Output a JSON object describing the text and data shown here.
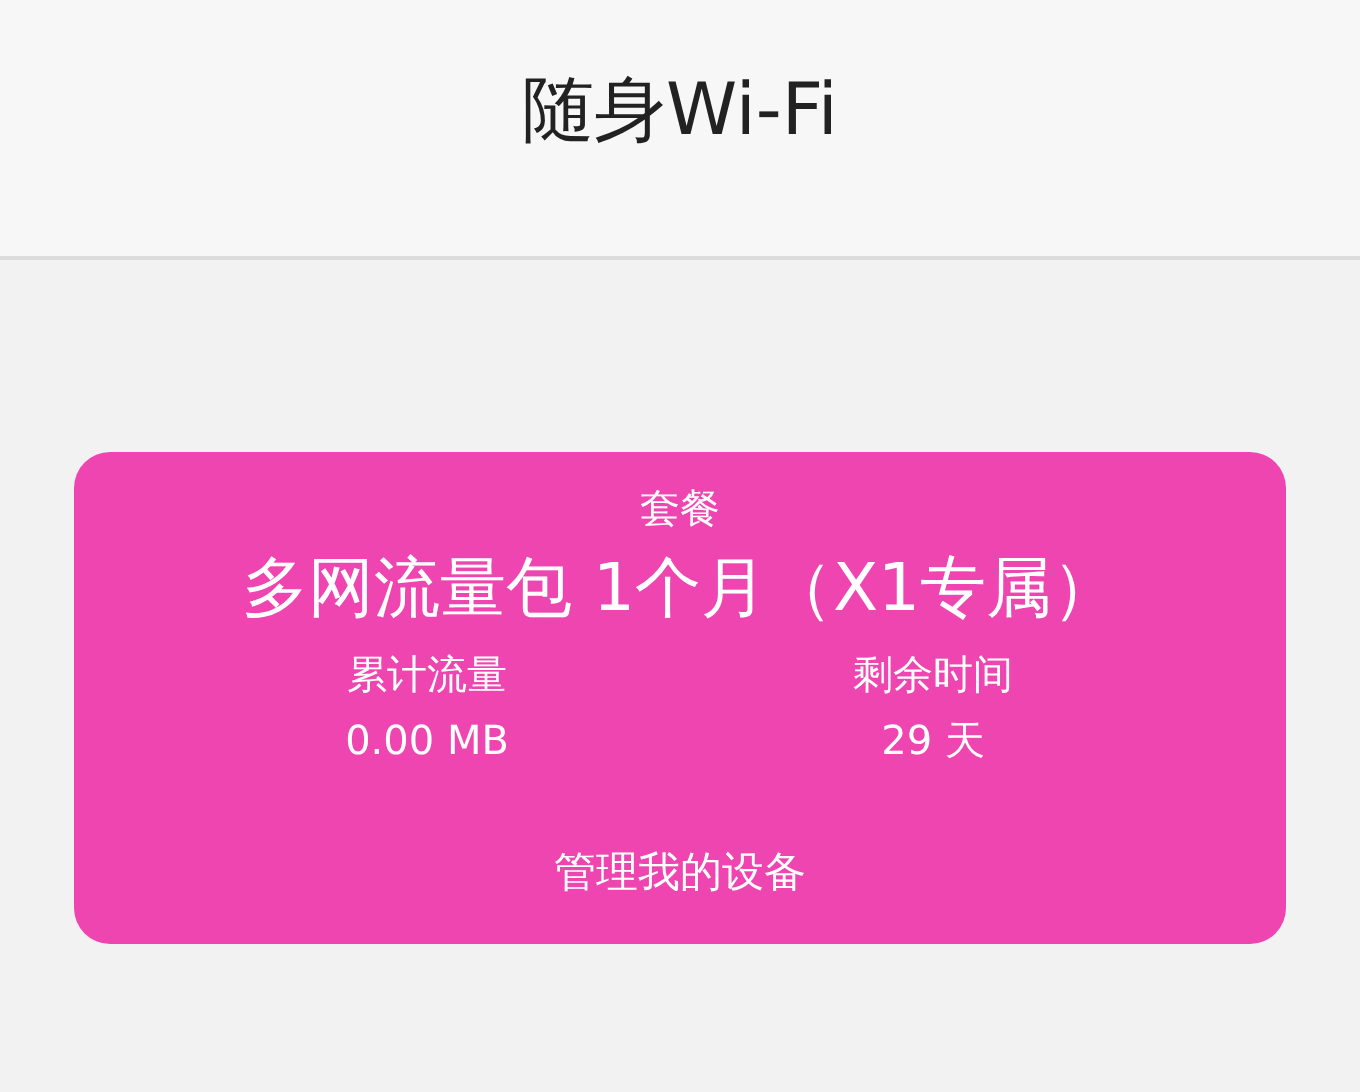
{
  "header": {
    "title": "随身Wi-Fi"
  },
  "plan_card": {
    "heading": "套餐",
    "plan_name": "多网流量包 1个月（X1专属）",
    "stats": [
      {
        "label": "累计流量",
        "value": "0.00 MB"
      },
      {
        "label": "剩余时间",
        "value": "29 天"
      }
    ],
    "manage_link": "管理我的设备"
  }
}
